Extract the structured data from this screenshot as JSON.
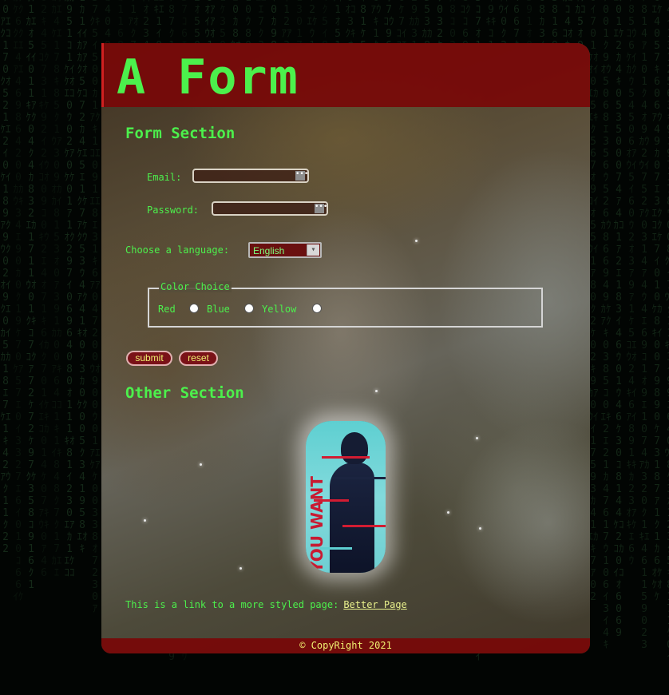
{
  "header": {
    "title": "A Form"
  },
  "form_section": {
    "heading": "Form Section",
    "email_label": "Email:",
    "email_value": "",
    "password_label": "Password:",
    "password_value": "",
    "language_label": "Choose a language:",
    "language_selected": "English",
    "color_fieldset": {
      "legend": "Color Choice",
      "options": [
        "Red",
        "Blue",
        "Yellow"
      ]
    },
    "submit_label": "submit",
    "reset_label": "reset"
  },
  "other_section": {
    "heading": "Other Section",
    "image_text": "YOU WANT"
  },
  "link_line": {
    "text": "This is a link to a more styled page:",
    "link_label": "Better Page"
  },
  "footer": {
    "text": "© CopyRight 2021"
  },
  "colors": {
    "accent_green": "#4cf04c",
    "header_red": "#780808",
    "link_yellow": "#e8f08c"
  }
}
